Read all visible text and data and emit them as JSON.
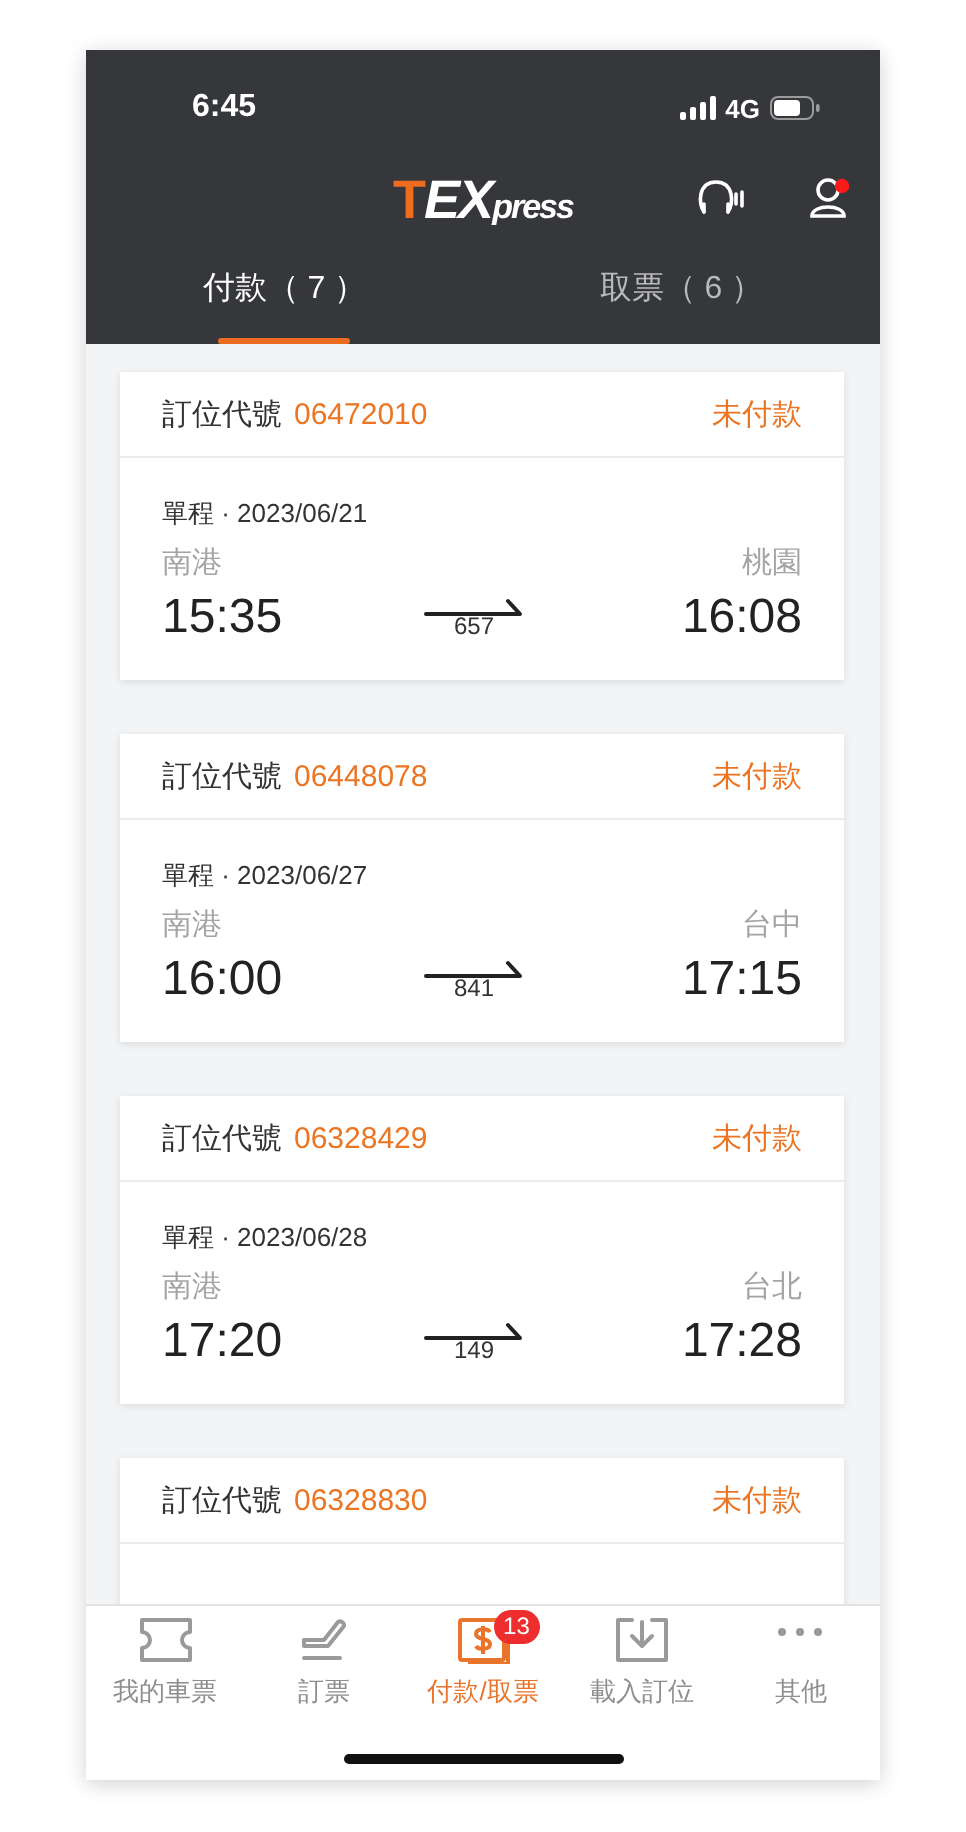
{
  "status_bar": {
    "time": "6:45",
    "network": "4G"
  },
  "logo": [
    {
      "text": "T",
      "kind": "accent"
    },
    {
      "text": "EX",
      "kind": "main"
    },
    {
      "text": "press",
      "kind": "small"
    }
  ],
  "profile": {
    "alert": true
  },
  "tabs": [
    {
      "label": "付款（ 7 ）",
      "selected": true
    },
    {
      "label": "取票（ 6 ）",
      "selected": false
    }
  ],
  "orders": [
    {
      "label": "訂位代號",
      "code": "06472010",
      "status": "未付款",
      "trip": "單程 · 2023/06/21",
      "from": "南港",
      "to": "桃園",
      "depart": "15:35",
      "arrive": "16:08",
      "train": "657"
    },
    {
      "label": "訂位代號",
      "code": "06448078",
      "status": "未付款",
      "trip": "單程 · 2023/06/27",
      "from": "南港",
      "to": "台中",
      "depart": "16:00",
      "arrive": "17:15",
      "train": "841"
    },
    {
      "label": "訂位代號",
      "code": "06328429",
      "status": "未付款",
      "trip": "單程 · 2023/06/28",
      "from": "南港",
      "to": "台北",
      "depart": "17:20",
      "arrive": "17:28",
      "train": "149"
    },
    {
      "label": "訂位代號",
      "code": "06328830",
      "status": "未付款"
    }
  ],
  "nav": [
    {
      "label": "我的車票",
      "selected": false
    },
    {
      "label": "訂票",
      "selected": false
    },
    {
      "label": "付款/取票",
      "selected": true,
      "badge": "13"
    },
    {
      "label": "載入訂位",
      "selected": false
    },
    {
      "label": "其他",
      "selected": false
    }
  ]
}
